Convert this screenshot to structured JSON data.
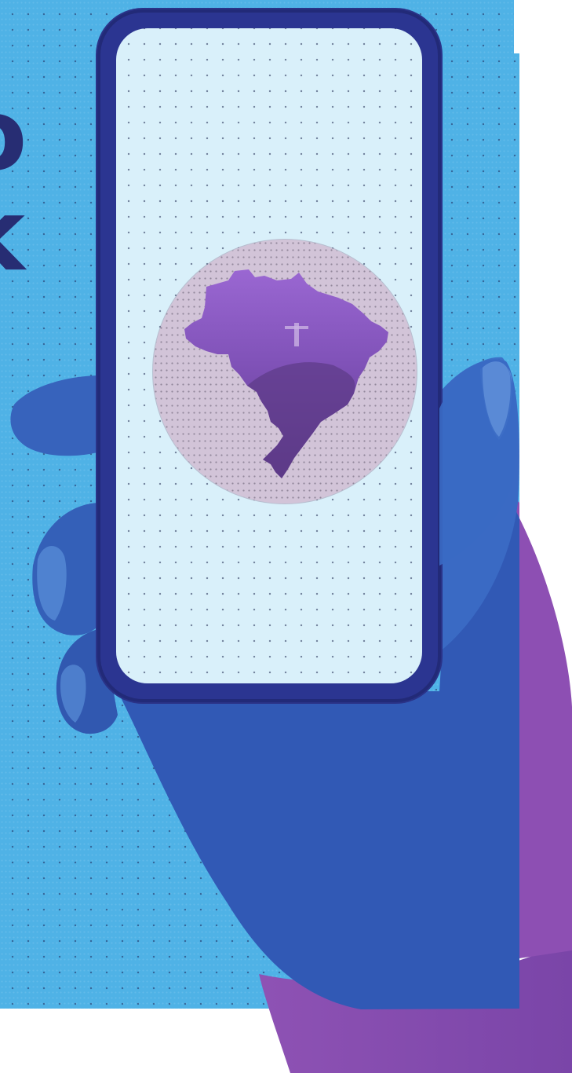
{
  "headline": {
    "fragment_line1": "o",
    "fragment_line2": "k"
  },
  "colors": {
    "panel_blue": "#4fb2e6",
    "phone_frame": "#2b3591",
    "screen_bg": "#d9f0fa",
    "hand_blue": "#3260b8",
    "hand_purple": "#8a4fae",
    "headline_navy": "#272d73",
    "map_purple": "#8e5bc4",
    "badge_lilac": "#d2c4d8"
  },
  "icons": {
    "map": "brazil-map-icon"
  }
}
